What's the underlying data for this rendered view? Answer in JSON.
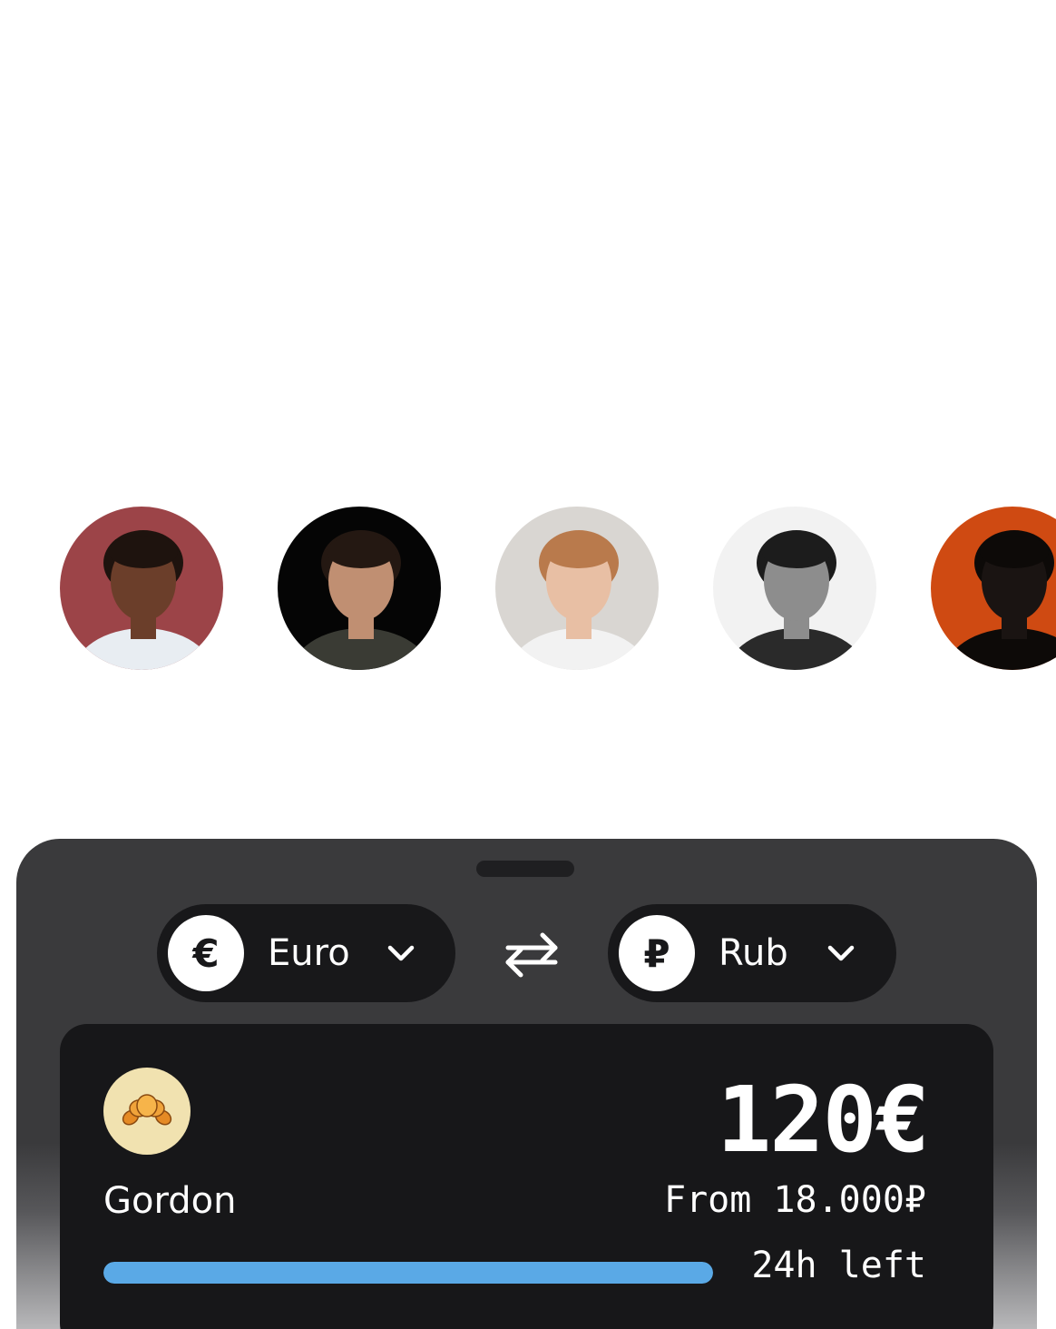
{
  "avatars": [
    {
      "name": "avatar-woman-red-wall",
      "bg": "#9c4448",
      "skin": "#6b3e2a",
      "hair": "#1e130e",
      "top": "#e8edf2"
    },
    {
      "name": "avatar-man-dark-sweater",
      "bg": "#050505",
      "skin": "#c08f72",
      "hair": "#241812",
      "top": "#3a3b34"
    },
    {
      "name": "avatar-young-man-white-tee",
      "bg": "#d9d6d2",
      "skin": "#e8bfa4",
      "hair": "#b97a4c",
      "top": "#f2f2f2"
    },
    {
      "name": "avatar-curly-bearded-man-bw",
      "bg": "#f2f2f2",
      "skin": "#8d8d8d",
      "hair": "#1c1c1c",
      "top": "#2a2a2a"
    },
    {
      "name": "avatar-man-orange-bg",
      "bg": "#cf4a12",
      "skin": "#1a1412",
      "hair": "#0d0a08",
      "top": "#0d0a08"
    }
  ],
  "converter": {
    "from": {
      "symbol": "€",
      "label": "Euro"
    },
    "to": {
      "symbol": "₽",
      "label": "Rub"
    }
  },
  "offer": {
    "merchant": "Gordon",
    "logo_icon": "croissant-icon",
    "amount": "120€",
    "from_text": "From 18.000₽",
    "time_left": "24h left",
    "progress": 1.0
  },
  "colors": {
    "sheet": "#3a3a3c",
    "card": "#171719",
    "pill": "#18181a",
    "accent": "#5aa9e6",
    "logo_bg": "#f1e2b0"
  }
}
